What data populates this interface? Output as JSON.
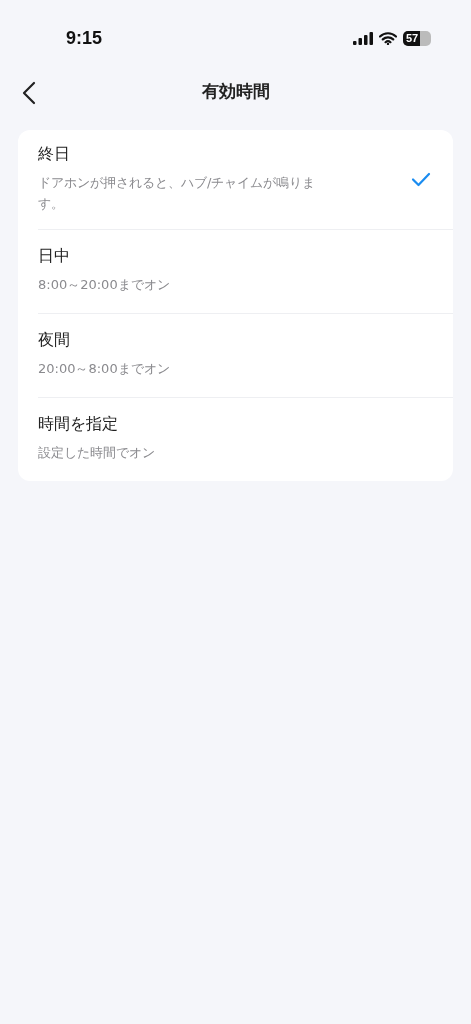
{
  "status_bar": {
    "time": "9:15",
    "battery": "57"
  },
  "header": {
    "title": "有効時間"
  },
  "options": [
    {
      "title": "終日",
      "description": "ドアホンが押されると、ハブ/チャイムが鳴ります。",
      "selected": true
    },
    {
      "title": "日中",
      "description": "8:00～20:00までオン",
      "selected": false
    },
    {
      "title": "夜間",
      "description": "20:00～8:00までオン",
      "selected": false
    },
    {
      "title": "時間を指定",
      "description": "設定した時間でオン",
      "selected": false
    }
  ]
}
